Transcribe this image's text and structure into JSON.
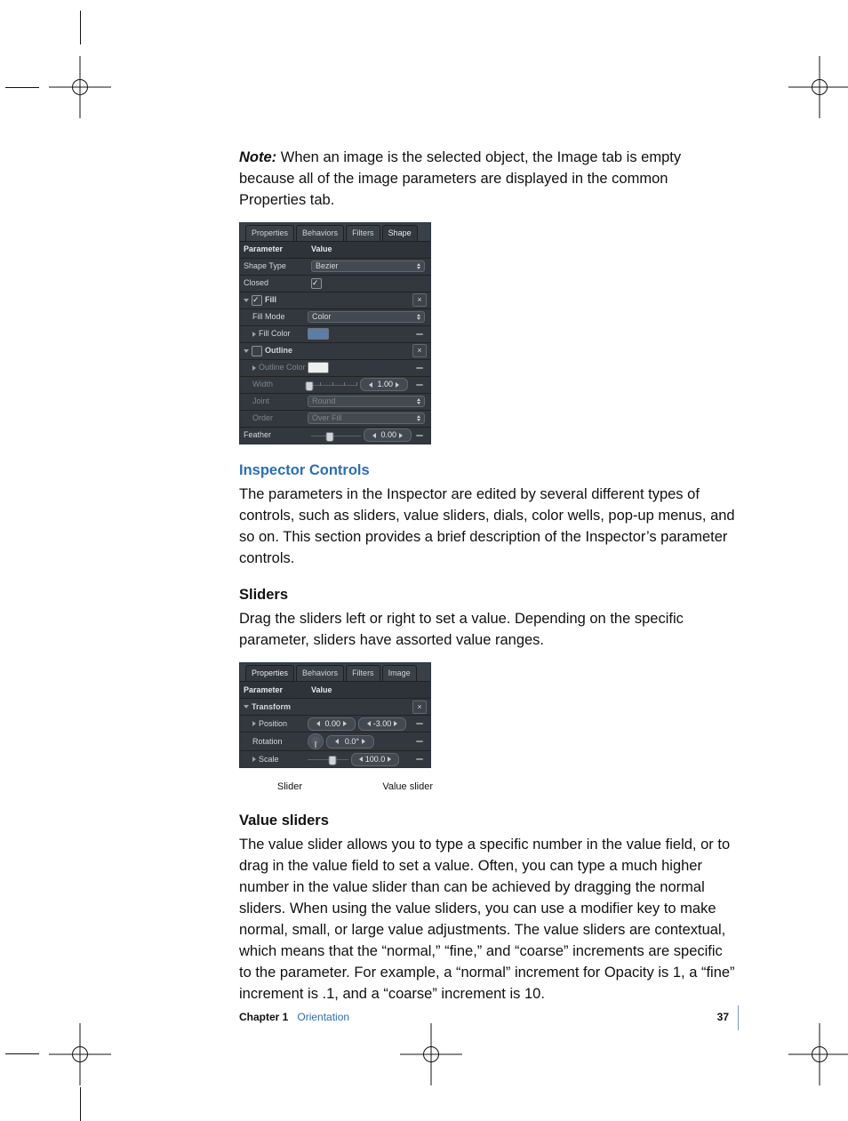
{
  "note_label": "Note:",
  "note_text": "  When an image is the selected object, the Image tab is empty because all of the image parameters are displayed in the common Properties tab.",
  "fig1": {
    "tabs": [
      "Properties",
      "Behaviors",
      "Filters",
      "Shape"
    ],
    "selected_tab": 3,
    "header_param": "Parameter",
    "header_value": "Value",
    "rows": {
      "shape_type_label": "Shape Type",
      "shape_type_value": "Bezier",
      "closed_label": "Closed",
      "fill_label": "Fill",
      "fill_mode_label": "Fill Mode",
      "fill_mode_value": "Color",
      "fill_color_label": "Fill Color",
      "outline_label": "Outline",
      "outline_color_label": "Outline Color",
      "width_label": "Width",
      "width_value": "1.00",
      "joint_label": "Joint",
      "joint_value": "Round",
      "order_label": "Order",
      "order_value": "Over Fill",
      "feather_label": "Feather",
      "feather_value": "0.00"
    }
  },
  "inspector_title": "Inspector Controls",
  "inspector_body": "The parameters in the Inspector are edited by several different types of controls, such as sliders, value sliders, dials, color wells, pop-up menus, and so on. This section provides a brief description of the Inspector’s parameter controls.",
  "sliders_title": "Sliders",
  "sliders_body": "Drag the sliders left or right to set a value. Depending on the specific parameter, sliders have assorted value ranges.",
  "fig2": {
    "tabs": [
      "Properties",
      "Behaviors",
      "Filters",
      "Image"
    ],
    "selected_tab": 0,
    "header_param": "Parameter",
    "header_value": "Value",
    "rows": {
      "transform_label": "Transform",
      "position_label": "Position",
      "position_x": "0.00",
      "position_y": "-3.00",
      "rotation_label": "Rotation",
      "rotation_value": "0.0°",
      "scale_label": "Scale",
      "scale_value": "100.0"
    }
  },
  "caption_slider": "Slider",
  "caption_value_slider": "Value slider",
  "value_sliders_title": "Value sliders",
  "value_sliders_body": "The value slider allows you to type a specific number in the value field, or to drag in the value field to set a value. Often, you can type a much higher number in the value slider than can be achieved by dragging the normal sliders. When using the value sliders, you can use a modifier key to make normal, small, or large value adjustments. The value sliders are contextual, which means that the “normal,” “fine,” and “coarse” increments are specific to the parameter. For example, a “normal” increment for Opacity is 1, a “fine” increment is .1, and a “coarse” increment is 10.",
  "footer_chapter_label": "Chapter 1",
  "footer_chapter_name": "Orientation",
  "footer_page": "37"
}
